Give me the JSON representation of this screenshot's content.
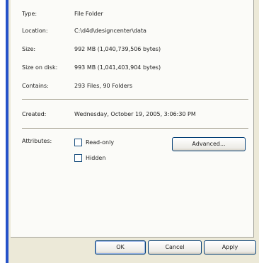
{
  "properties": {
    "type": {
      "label": "Type:",
      "value": "File Folder"
    },
    "location": {
      "label": "Location:",
      "value": "C:\\d4d\\designcenter\\data"
    },
    "size": {
      "label": "Size:",
      "value": "992 MB (1,040,739,506 bytes)"
    },
    "size_on_disk": {
      "label": "Size on disk:",
      "value": "993 MB (1,041,403,904 bytes)"
    },
    "contains": {
      "label": "Contains:",
      "value": "293 Files, 90 Folders"
    },
    "created": {
      "label": "Created:",
      "value": "Wednesday, October 19, 2005, 3:06:30 PM"
    }
  },
  "attributes": {
    "label": "Attributes:",
    "read_only": {
      "label": "Read-only",
      "checked": false
    },
    "hidden": {
      "label": "Hidden",
      "checked": false
    },
    "advanced_label": "Advanced..."
  },
  "footer": {
    "ok_label": "OK",
    "cancel_label": "Cancel",
    "apply_label": "Apply"
  },
  "colors": {
    "window_frame": "#2552c9",
    "dialog_background": "#ece9d8",
    "tab_page_background": "#fbfbf8",
    "button_border": "#003c74"
  }
}
